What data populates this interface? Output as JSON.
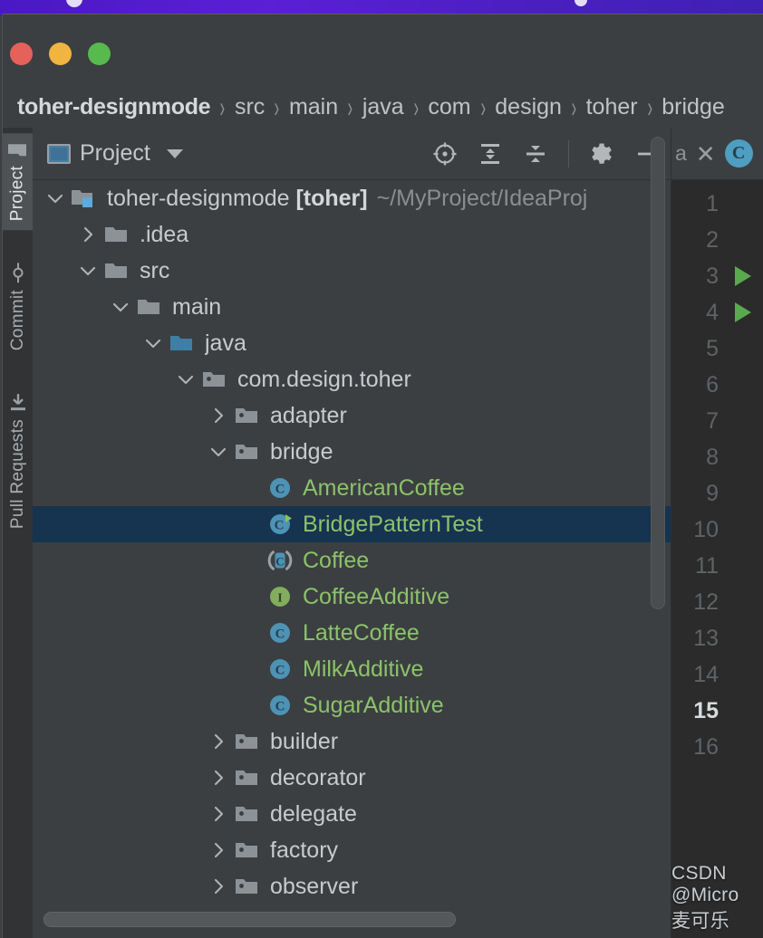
{
  "window": {
    "traffic_lights": [
      {
        "name": "close",
        "color": "#e5625a"
      },
      {
        "name": "minimize",
        "color": "#f0b440"
      },
      {
        "name": "maximize",
        "color": "#58b94e"
      }
    ]
  },
  "breadcrumbs": {
    "separator": "›",
    "items": [
      "toher-designmode",
      "src",
      "main",
      "java",
      "com",
      "design",
      "toher",
      "bridge"
    ]
  },
  "project_panel": {
    "title": "Project",
    "title_icon": "project-window-icon",
    "dropdown_icon": "chevron-down-icon",
    "actions": [
      {
        "name": "select-opened-file-icon",
        "label": "Select Opened File"
      },
      {
        "name": "expand-all-icon",
        "label": "Expand All"
      },
      {
        "name": "collapse-all-icon",
        "label": "Collapse All"
      },
      {
        "name": "settings-gear-icon",
        "label": "Settings"
      },
      {
        "name": "hide-panel-icon",
        "label": "Hide"
      }
    ],
    "tree": [
      {
        "label": "toher-designmode",
        "bold_suffix": "[toher]",
        "path": "~/MyProject/IdeaProj",
        "icon": "module-folder-icon",
        "twist": "expanded",
        "depth": 0,
        "kind": "module",
        "selected": false
      },
      {
        "label": ".idea",
        "icon": "folder-icon",
        "twist": "collapsed",
        "depth": 1,
        "kind": "folder",
        "selected": false
      },
      {
        "label": "src",
        "icon": "folder-icon",
        "twist": "expanded",
        "depth": 1,
        "kind": "folder",
        "selected": false
      },
      {
        "label": "main",
        "icon": "folder-icon",
        "twist": "expanded",
        "depth": 2,
        "kind": "folder",
        "selected": false
      },
      {
        "label": "java",
        "icon": "source-root-folder-icon",
        "twist": "expanded",
        "depth": 3,
        "kind": "source-root",
        "selected": false
      },
      {
        "label": "com.design.toher",
        "icon": "package-icon",
        "twist": "expanded",
        "depth": 4,
        "kind": "package",
        "selected": false
      },
      {
        "label": "adapter",
        "icon": "package-icon",
        "twist": "collapsed",
        "depth": 5,
        "kind": "package",
        "selected": false
      },
      {
        "label": "bridge",
        "icon": "package-icon",
        "twist": "expanded",
        "depth": 5,
        "kind": "package",
        "selected": false
      },
      {
        "label": "AmericanCoffee",
        "icon": "java-class-icon",
        "twist": "none",
        "depth": 6,
        "kind": "class",
        "selected": false
      },
      {
        "label": "BridgePatternTest",
        "icon": "java-runnable-class-icon",
        "twist": "none",
        "depth": 6,
        "kind": "runnable-class",
        "selected": true
      },
      {
        "label": "Coffee",
        "icon": "java-abstract-class-icon",
        "twist": "none",
        "depth": 6,
        "kind": "abstract-class",
        "selected": false
      },
      {
        "label": "CoffeeAdditive",
        "icon": "java-interface-icon",
        "twist": "none",
        "depth": 6,
        "kind": "interface",
        "selected": false
      },
      {
        "label": "LatteCoffee",
        "icon": "java-class-icon",
        "twist": "none",
        "depth": 6,
        "kind": "class",
        "selected": false
      },
      {
        "label": "MilkAdditive",
        "icon": "java-class-icon",
        "twist": "none",
        "depth": 6,
        "kind": "class",
        "selected": false
      },
      {
        "label": "SugarAdditive",
        "icon": "java-class-icon",
        "twist": "none",
        "depth": 6,
        "kind": "class",
        "selected": false
      },
      {
        "label": "builder",
        "icon": "package-icon",
        "twist": "collapsed",
        "depth": 5,
        "kind": "package",
        "selected": false
      },
      {
        "label": "decorator",
        "icon": "package-icon",
        "twist": "collapsed",
        "depth": 5,
        "kind": "package",
        "selected": false
      },
      {
        "label": "delegate",
        "icon": "package-icon",
        "twist": "collapsed",
        "depth": 5,
        "kind": "package",
        "selected": false
      },
      {
        "label": "factory",
        "icon": "package-icon",
        "twist": "collapsed",
        "depth": 5,
        "kind": "package",
        "selected": false
      },
      {
        "label": "observer",
        "icon": "package-icon",
        "twist": "collapsed",
        "depth": 5,
        "kind": "package",
        "selected": false
      }
    ]
  },
  "sidebar": {
    "items": [
      {
        "label": "Project",
        "icon": "folder-icon",
        "active": true
      },
      {
        "label": "Commit",
        "icon": "commit-node-icon",
        "active": false
      },
      {
        "label": "Pull Requests",
        "icon": "pull-request-icon",
        "active": false
      }
    ]
  },
  "editor": {
    "tab": {
      "truncated_name": "a",
      "close_icon": "close-icon"
    },
    "next_tab_icon": {
      "name": "java-class-icon",
      "letter": "C"
    },
    "line_numbers": [
      "1",
      "2",
      "3",
      "4",
      "5",
      "6",
      "7",
      "8",
      "9",
      "10",
      "11",
      "12",
      "13",
      "14",
      "15",
      "16"
    ],
    "current_line": "15",
    "run_gutter_lines": [
      "3",
      "4"
    ],
    "run_icon": "run-arrow-icon"
  },
  "watermark": "CSDN @Micro麦可乐",
  "colors": {
    "panel_bg": "#3c3f41",
    "toolstrip_bg": "#313335",
    "editor_bg": "#2b2b2b",
    "selection": "#16334f",
    "class_green": "#8cc26b",
    "accent_blue": "#4d9ec0",
    "run_green": "#5aa94f",
    "desktop": "#5b1fd6"
  }
}
